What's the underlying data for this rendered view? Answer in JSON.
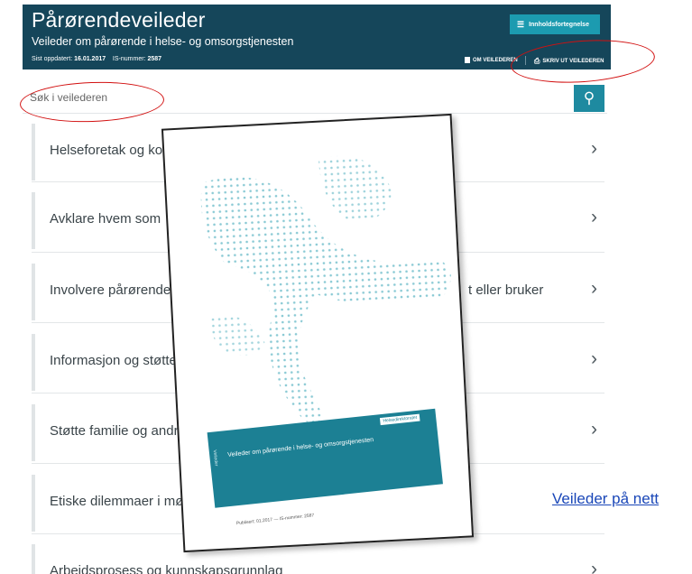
{
  "header": {
    "title": "Pårørendeveileder",
    "subtitle": "Veileder om pårørende i helse- og omsorgstjenesten",
    "updated_label": "Sist oppdatert:",
    "updated_value": "16.01.2017",
    "is_label": "IS-nummer:",
    "is_value": "2587",
    "toc_label": "Innholdsfortegnelse",
    "about_label": "OM VEILEDEREN",
    "print_label": "SKRIV UT VEILEDEREN"
  },
  "search": {
    "placeholder": "Søk i veilederen"
  },
  "items": [
    {
      "label": "Helseforetak og kommuners plikt"
    },
    {
      "label": "Avklare hvem som"
    },
    {
      "label": "Involvere pårørende"
    },
    {
      "label": "Informasjon og støtte"
    },
    {
      "label": "Støtte familie og andre"
    },
    {
      "label": "Etiske dilemmaer i møte"
    },
    {
      "label": "Arbeidsprosess og kunnskapsgrunnlag"
    }
  ],
  "items_right": {
    "involvere_tail": "t eller bruker"
  },
  "booklet": {
    "band_title": "Veileder om pårørende i helse- og omsorgstjenesten",
    "band_side": "Veileder",
    "brand": "Helsedirektoratet",
    "footer": "Publisert: 01.2017 — IS-nummer: 2587"
  },
  "link": {
    "label": "Veileder på nett"
  },
  "colors": {
    "header_bg": "#15465a",
    "accent": "#1c9bb0",
    "annotation": "#d21010",
    "link": "#1a47b8"
  }
}
